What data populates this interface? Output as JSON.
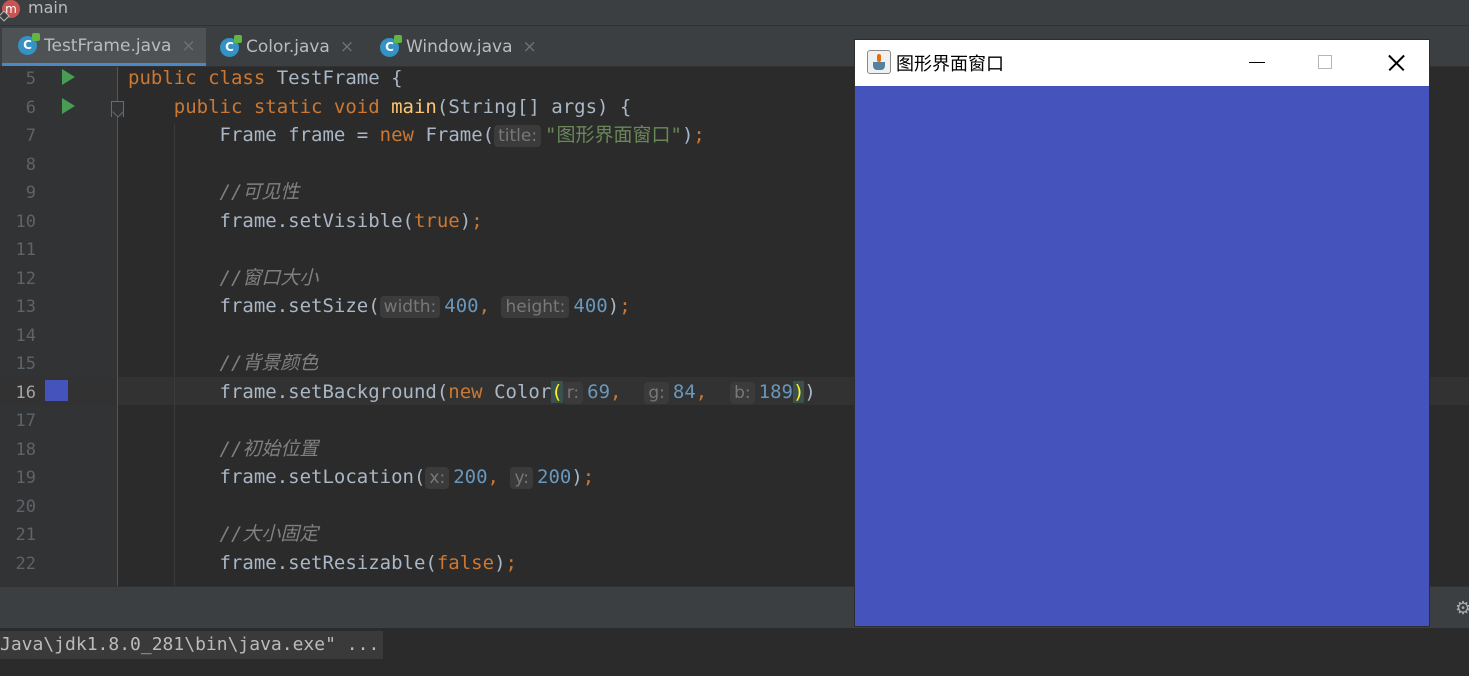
{
  "breadcrumb": {
    "icon_letter": "m",
    "label": "main"
  },
  "tabs": [
    {
      "label": "TestFrame.java",
      "icon_letter": "C",
      "active": true
    },
    {
      "label": "Color.java",
      "icon_letter": "C",
      "active": false
    },
    {
      "label": "Window.java",
      "icon_letter": "C",
      "active": false
    }
  ],
  "tab_close_glyph": "×",
  "editor": {
    "current_line": 16,
    "swatch_color": "#4554bd",
    "lines": [
      {
        "n": "5",
        "tokens": [
          {
            "t": "kw",
            "v": "public class "
          },
          {
            "t": "plain",
            "v": "TestFrame {"
          }
        ]
      },
      {
        "n": "6",
        "tokens": [
          {
            "t": "kw",
            "v": "    public static void "
          },
          {
            "t": "fn",
            "v": "main"
          },
          {
            "t": "plain",
            "v": "(String[] args) {"
          }
        ]
      },
      {
        "n": "7",
        "tokens": [
          {
            "t": "plain",
            "v": "        Frame frame = "
          },
          {
            "t": "kw",
            "v": "new "
          },
          {
            "t": "plain",
            "v": "Frame("
          },
          {
            "t": "hint",
            "v": "title:"
          },
          {
            "t": "str",
            "v": "\"图形界面窗口\""
          },
          {
            "t": "plain",
            "v": ")"
          },
          {
            "t": "kw",
            "v": ";"
          }
        ]
      },
      {
        "n": "8",
        "tokens": []
      },
      {
        "n": "9",
        "tokens": [
          {
            "t": "cmt",
            "v": "        //可见性"
          }
        ]
      },
      {
        "n": "10",
        "tokens": [
          {
            "t": "plain",
            "v": "        frame.setVisible("
          },
          {
            "t": "kw",
            "v": "true"
          },
          {
            "t": "plain",
            "v": ")"
          },
          {
            "t": "kw",
            "v": ";"
          }
        ]
      },
      {
        "n": "11",
        "tokens": []
      },
      {
        "n": "12",
        "tokens": [
          {
            "t": "cmt",
            "v": "        //窗口大小"
          }
        ]
      },
      {
        "n": "13",
        "tokens": [
          {
            "t": "plain",
            "v": "        frame.setSize("
          },
          {
            "t": "hint",
            "v": "width:"
          },
          {
            "t": "num",
            "v": "400"
          },
          {
            "t": "kw",
            "v": ", "
          },
          {
            "t": "hint",
            "v": "height:"
          },
          {
            "t": "num",
            "v": "400"
          },
          {
            "t": "plain",
            "v": ")"
          },
          {
            "t": "kw",
            "v": ";"
          }
        ]
      },
      {
        "n": "14",
        "tokens": []
      },
      {
        "n": "15",
        "tokens": [
          {
            "t": "cmt",
            "v": "        //背景颜色"
          }
        ]
      },
      {
        "n": "16",
        "tokens": [
          {
            "t": "plain",
            "v": "        frame.setBackground("
          },
          {
            "t": "kw",
            "v": "new "
          },
          {
            "t": "plain",
            "v": "Color"
          },
          {
            "t": "match",
            "v": "("
          },
          {
            "t": "hint",
            "v": "r:"
          },
          {
            "t": "num",
            "v": "69"
          },
          {
            "t": "kw",
            "v": ",  "
          },
          {
            "t": "hint",
            "v": "g:"
          },
          {
            "t": "num",
            "v": "84"
          },
          {
            "t": "kw",
            "v": ",  "
          },
          {
            "t": "hint",
            "v": "b:"
          },
          {
            "t": "num",
            "v": "189"
          },
          {
            "t": "match",
            "v": ")"
          },
          {
            "t": "plain",
            "v": ")"
          }
        ]
      },
      {
        "n": "17",
        "tokens": []
      },
      {
        "n": "18",
        "tokens": [
          {
            "t": "cmt",
            "v": "        //初始位置"
          }
        ]
      },
      {
        "n": "19",
        "tokens": [
          {
            "t": "plain",
            "v": "        frame.setLocation("
          },
          {
            "t": "hint",
            "v": "x:"
          },
          {
            "t": "num",
            "v": "200"
          },
          {
            "t": "kw",
            "v": ", "
          },
          {
            "t": "hint",
            "v": "y:"
          },
          {
            "t": "num",
            "v": "200"
          },
          {
            "t": "plain",
            "v": ")"
          },
          {
            "t": "kw",
            "v": ";"
          }
        ]
      },
      {
        "n": "20",
        "tokens": []
      },
      {
        "n": "21",
        "tokens": [
          {
            "t": "cmt",
            "v": "        //大小固定"
          }
        ]
      },
      {
        "n": "22",
        "tokens": [
          {
            "t": "plain",
            "v": "        frame.setResizable("
          },
          {
            "t": "kw",
            "v": "false"
          },
          {
            "t": "plain",
            "v": ")"
          },
          {
            "t": "kw",
            "v": ";"
          }
        ]
      }
    ]
  },
  "console": {
    "text": "Java\\jdk1.8.0_281\\bin\\java.exe\" ..."
  },
  "awt_window": {
    "title": "图形界面窗口",
    "background": "#4554bd",
    "icons": {
      "app": "java-icon",
      "minimize": "minimize-icon",
      "maximize": "maximize-icon",
      "close": "close-icon"
    }
  }
}
